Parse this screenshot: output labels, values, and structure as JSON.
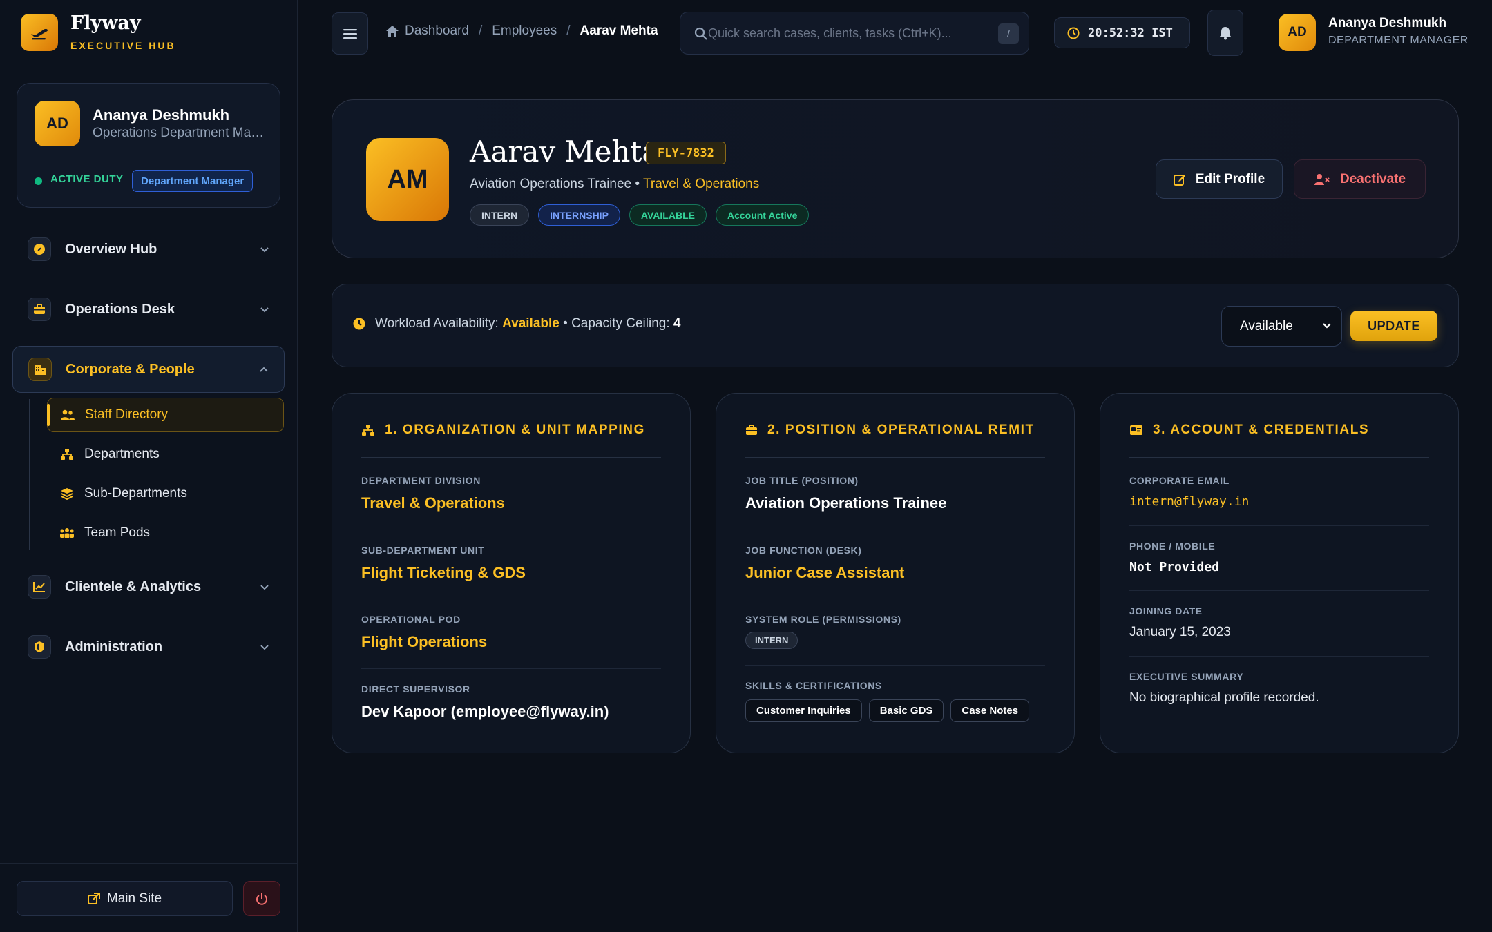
{
  "brand": {
    "title": "Flyway",
    "subtitle": "EXECUTIVE HUB"
  },
  "sidebar": {
    "profile": {
      "initials": "AD",
      "name": "Ananya Deshmukh",
      "role": "Operations Department Manager",
      "status": "ACTIVE DUTY",
      "badge": "Department Manager"
    },
    "nav": [
      {
        "label": "Overview Hub",
        "icon": "compass-icon"
      },
      {
        "label": "Operations Desk",
        "icon": "briefcase-icon"
      },
      {
        "label": "Corporate & People",
        "icon": "building-icon"
      },
      {
        "label": "Clientele & Analytics",
        "icon": "chart-line-icon"
      },
      {
        "label": "Administration",
        "icon": "shield-icon"
      }
    ],
    "subnav": [
      {
        "label": "Staff Directory",
        "icon": "users-icon"
      },
      {
        "label": "Departments",
        "icon": "sitemap-icon"
      },
      {
        "label": "Sub-Departments",
        "icon": "layers-icon"
      },
      {
        "label": "Team Pods",
        "icon": "people-group-icon"
      }
    ],
    "footer": {
      "main_site": "Main Site"
    }
  },
  "topbar": {
    "breadcrumb": [
      "Dashboard",
      "Employees",
      "Aarav Mehta"
    ],
    "search_placeholder": "Quick search cases, clients, tasks (Ctrl+K)...",
    "search_key": "/",
    "clock": "20:52:32 IST",
    "user": {
      "initials": "AD",
      "name": "Ananya Deshmukh",
      "role": "DEPARTMENT MANAGER"
    }
  },
  "employee": {
    "initials": "AM",
    "name": "Aarav Mehta",
    "id": "FLY-7832",
    "title": "Aviation Operations Trainee",
    "separator": "•",
    "department": "Travel & Operations",
    "tags": [
      "INTERN",
      "INTERNSHIP",
      "AVAILABLE",
      "Account Active"
    ],
    "actions": {
      "edit": "Edit Profile",
      "deactivate": "Deactivate"
    }
  },
  "workload": {
    "label": "Workload Availability:",
    "status": "Available",
    "capacity_label": "• Capacity Ceiling:",
    "capacity": "4",
    "select_value": "Available",
    "update_label": "UPDATE"
  },
  "cards": {
    "org": {
      "title": "1. ORGANIZATION & UNIT MAPPING",
      "fields": [
        {
          "label": "DEPARTMENT DIVISION",
          "value": "Travel & Operations"
        },
        {
          "label": "SUB-DEPARTMENT UNIT",
          "value": "Flight Ticketing & GDS"
        },
        {
          "label": "OPERATIONAL POD",
          "value": "Flight Operations"
        },
        {
          "label": "DIRECT SUPERVISOR",
          "value": "Dev Kapoor (employee@flyway.in)"
        }
      ]
    },
    "position": {
      "title": "2. POSITION & OPERATIONAL REMIT",
      "job_title_label": "JOB TITLE (POSITION)",
      "job_title": "Aviation Operations Trainee",
      "job_function_label": "JOB FUNCTION (DESK)",
      "job_function": "Junior Case Assistant",
      "system_role_label": "SYSTEM ROLE (PERMISSIONS)",
      "system_role": "INTERN",
      "skills_label": "SKILLS & CERTIFICATIONS",
      "skills": [
        "Customer Inquiries",
        "Basic GDS",
        "Case Notes"
      ]
    },
    "account": {
      "title": "3. ACCOUNT & CREDENTIALS",
      "email_label": "CORPORATE EMAIL",
      "email": "intern@flyway.in",
      "phone_label": "PHONE / MOBILE",
      "phone": "Not Provided",
      "joining_label": "JOINING DATE",
      "joining": "January 15, 2023",
      "summary_label": "EXECUTIVE SUMMARY",
      "summary": "No biographical profile recorded."
    }
  },
  "colors": {
    "accent": "#fbbf24",
    "background": "#0b1019",
    "success": "#34d399",
    "danger": "#f87171",
    "info": "#60a5fa"
  }
}
